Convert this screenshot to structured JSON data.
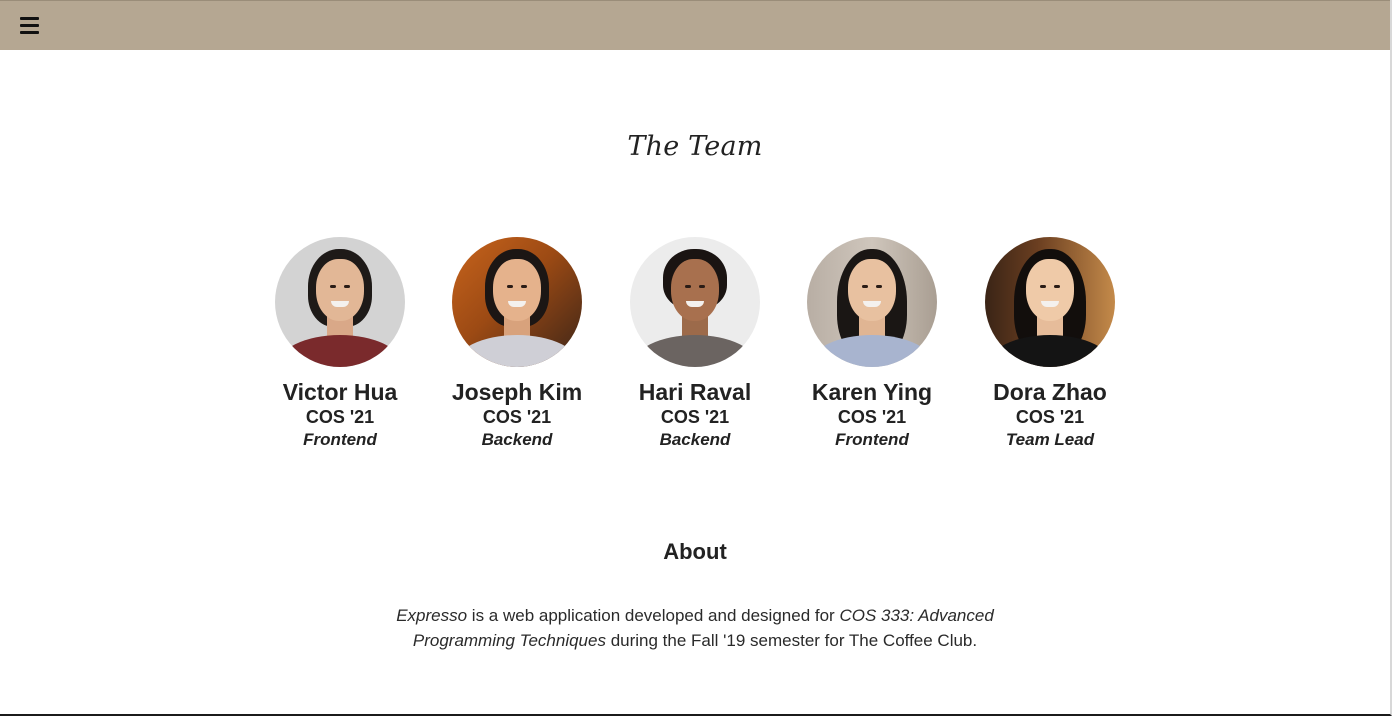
{
  "header": {
    "menu_icon": "hamburger-menu-icon",
    "background_color": "#b5a792"
  },
  "team_section": {
    "title": "The Team",
    "members": [
      {
        "name": "Victor Hua",
        "class_year": "COS '21",
        "role": "Frontend"
      },
      {
        "name": "Joseph Kim",
        "class_year": "COS '21",
        "role": "Backend"
      },
      {
        "name": "Hari Raval",
        "class_year": "COS '21",
        "role": "Backend"
      },
      {
        "name": "Karen Ying",
        "class_year": "COS '21",
        "role": "Frontend"
      },
      {
        "name": "Dora Zhao",
        "class_year": "COS '21",
        "role": "Team Lead"
      }
    ]
  },
  "about_section": {
    "heading": "About",
    "app_name": "Expresso",
    "text_part1": " is a web application developed and designed for ",
    "course": "COS 333: Advanced Programming Techniques",
    "text_part2": " during the Fall '19 semester for The Coffee Club."
  }
}
